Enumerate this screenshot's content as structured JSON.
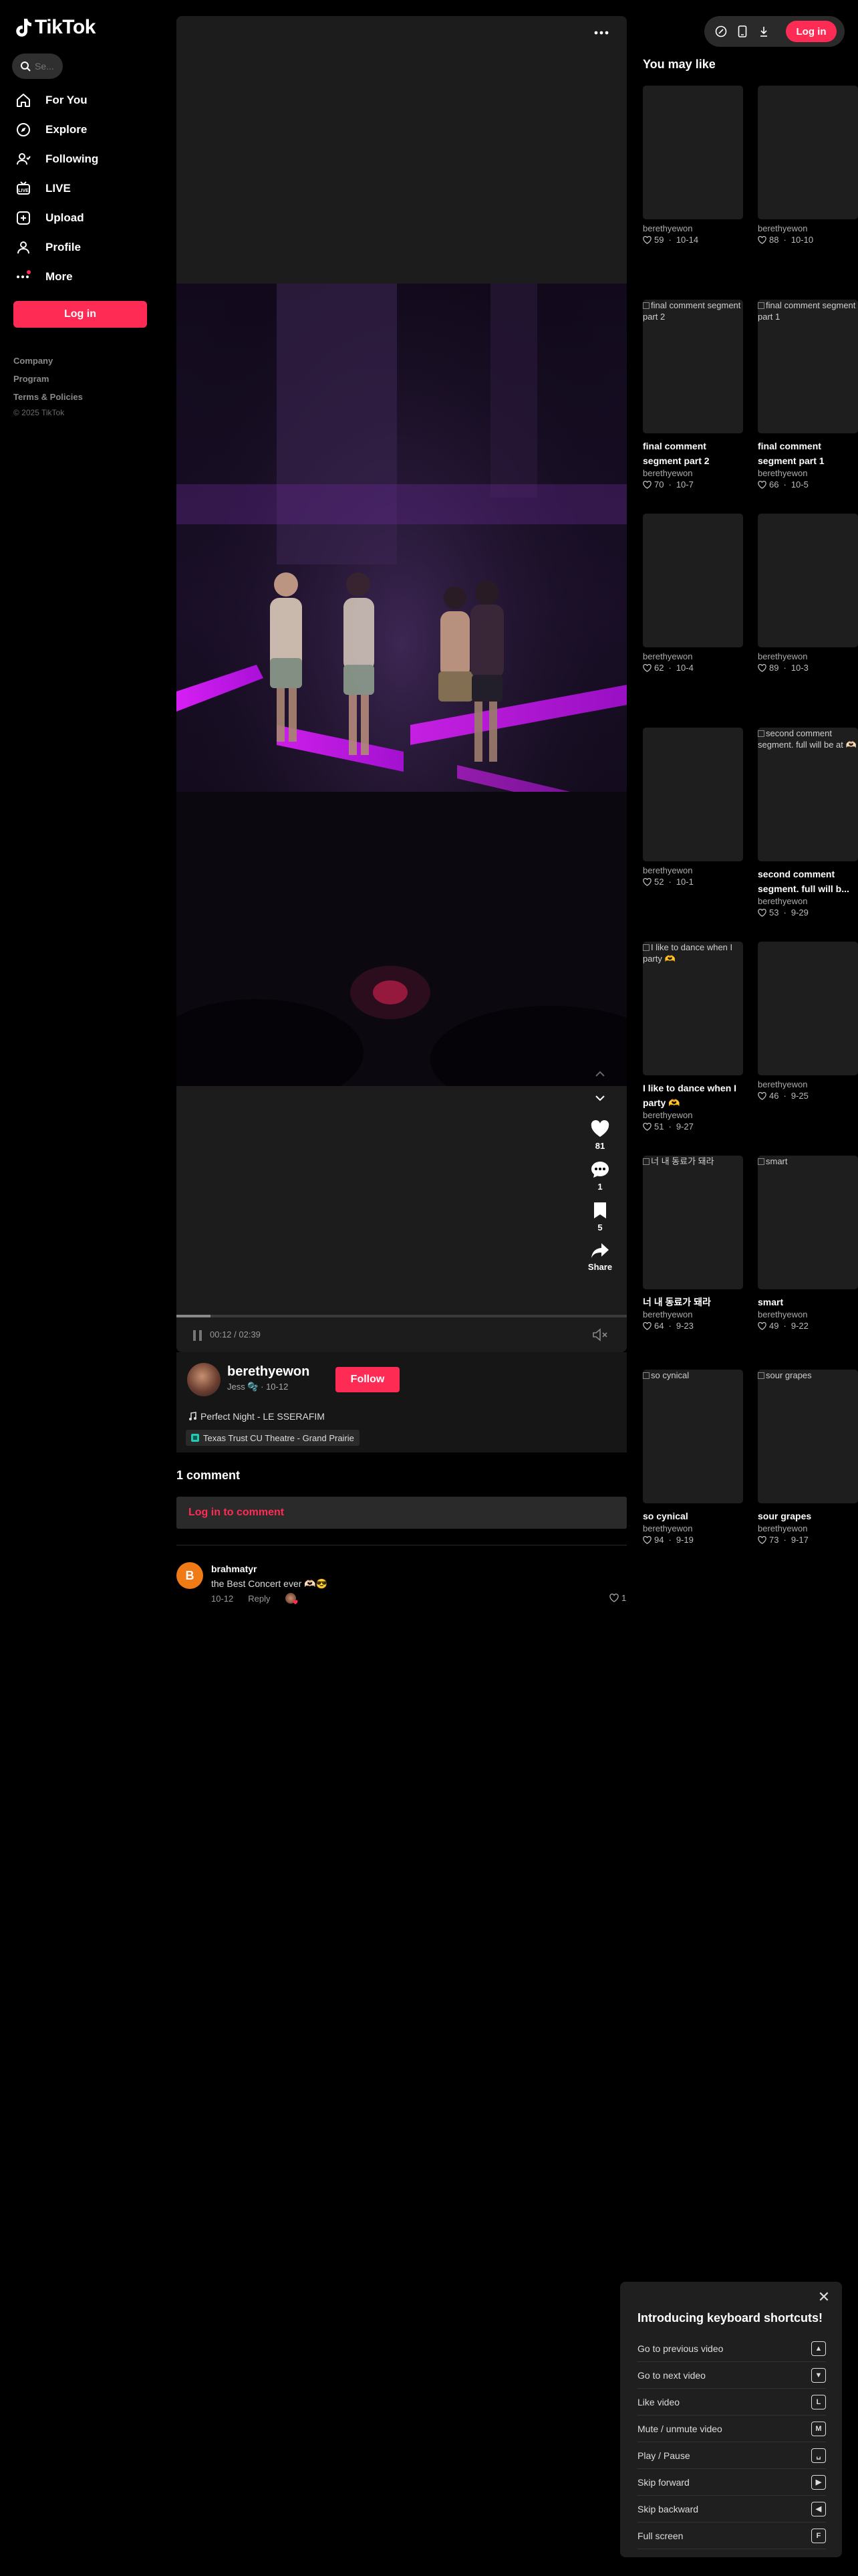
{
  "app": {
    "brand": "TikTok"
  },
  "search": {
    "placeholder": "Se..."
  },
  "sidebar": {
    "items": [
      {
        "label": "For You",
        "icon": "home-icon"
      },
      {
        "label": "Explore",
        "icon": "compass-icon"
      },
      {
        "label": "Following",
        "icon": "following-icon"
      },
      {
        "label": "LIVE",
        "icon": "live-icon"
      },
      {
        "label": "Upload",
        "icon": "upload-icon"
      },
      {
        "label": "Profile",
        "icon": "profile-icon"
      },
      {
        "label": "More",
        "icon": "more-dots-icon"
      }
    ],
    "login_label": "Log in",
    "footer_links": [
      "Company",
      "Program",
      "Terms & Policies"
    ],
    "copyright": "© 2025 TikTok"
  },
  "header": {
    "login_label": "Log in"
  },
  "video": {
    "more_label": "···",
    "likes": "81",
    "comments": "1",
    "saves": "5",
    "share_label": "Share",
    "timecode": "00:12 / 02:39",
    "progress_fraction": 0.075
  },
  "author": {
    "name": "berethyewon",
    "sub": "Jess 🫧 · 10-12",
    "follow_label": "Follow",
    "music": "Perfect Night - LE SSERAFIM",
    "location": "Texas Trust CU Theatre - Grand Prairie"
  },
  "comments": {
    "count_label": "1 comment",
    "login_prompt": "Log in to comment",
    "items": [
      {
        "avatar_letter": "B",
        "user": "brahmatyr",
        "text": "the Best Concert ever 🫶🏻😎",
        "date": "10-12",
        "reply_label": "Reply",
        "likes": "1"
      }
    ]
  },
  "recommendations": {
    "heading": "You may like",
    "items": [
      {
        "alt": "",
        "title": "",
        "user": "berethyewon",
        "likes": "59",
        "date": "10-14"
      },
      {
        "alt": "",
        "title": "",
        "user": "berethyewon",
        "likes": "88",
        "date": "10-10"
      },
      {
        "alt": "final comment segment part 2",
        "title": "final comment segment part 2",
        "user": "berethyewon",
        "likes": "70",
        "date": "10-7"
      },
      {
        "alt": "final comment segment part 1",
        "title": "final comment segment part 1",
        "user": "berethyewon",
        "likes": "66",
        "date": "10-5"
      },
      {
        "alt": "",
        "title": "",
        "user": "berethyewon",
        "likes": "62",
        "date": "10-4"
      },
      {
        "alt": "",
        "title": "",
        "user": "berethyewon",
        "likes": "89",
        "date": "10-3"
      },
      {
        "alt": "",
        "title": "",
        "user": "berethyewon",
        "likes": "52",
        "date": "10-1"
      },
      {
        "alt": "second comment segment. full will be at 🫶🏻",
        "title": "second comment segment. full will b...",
        "user": "berethyewon",
        "likes": "53",
        "date": "9-29"
      },
      {
        "alt": "I like to dance when I party 🫶",
        "title": "I like to dance when I party 🫶",
        "user": "berethyewon",
        "likes": "51",
        "date": "9-27"
      },
      {
        "alt": "",
        "title": "",
        "user": "berethyewon",
        "likes": "46",
        "date": "9-25"
      },
      {
        "alt": "너 내 동료가 돼라",
        "title": "너 내 동료가 돼라",
        "user": "berethyewon",
        "likes": "64",
        "date": "9-23"
      },
      {
        "alt": "smart",
        "title": "smart",
        "user": "berethyewon",
        "likes": "49",
        "date": "9-22"
      },
      {
        "alt": "so cynical",
        "title": "so cynical",
        "user": "berethyewon",
        "likes": "94",
        "date": "9-19"
      },
      {
        "alt": "sour grapes",
        "title": "sour grapes",
        "user": "berethyewon",
        "likes": "73",
        "date": "9-17"
      }
    ]
  },
  "keyboard_popup": {
    "title": "Introducing keyboard shortcuts!",
    "close_label": "✕",
    "rows": [
      {
        "label": "Go to previous video",
        "key": "▲"
      },
      {
        "label": "Go to next video",
        "key": "▼"
      },
      {
        "label": "Like video",
        "key": "L"
      },
      {
        "label": "Mute / unmute video",
        "key": "M"
      },
      {
        "label": "Play / Pause",
        "key": "␣"
      },
      {
        "label": "Skip forward",
        "key": "▶"
      },
      {
        "label": "Skip backward",
        "key": "◀"
      },
      {
        "label": "Full screen",
        "key": "F"
      }
    ]
  },
  "colors": {
    "accent": "#fe2c55",
    "background": "#000000",
    "panel": "#161616"
  }
}
